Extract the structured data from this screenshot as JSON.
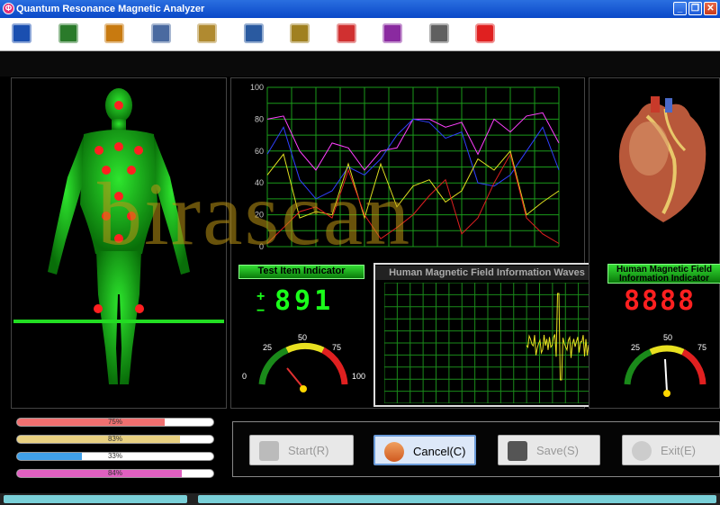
{
  "window": {
    "title": "Quantum Resonance Magnetic Analyzer",
    "min": "_",
    "restore": "❐",
    "close": "✕"
  },
  "toolbar": [
    {
      "name": "home-icon",
      "color": "#1a4fb0"
    },
    {
      "name": "users-icon",
      "color": "#2a7a2a"
    },
    {
      "name": "hand-icon",
      "color": "#c87a10"
    },
    {
      "name": "report-icon",
      "color": "#4a6aa0"
    },
    {
      "name": "edit-icon",
      "color": "#b08a30"
    },
    {
      "name": "save-disk-icon",
      "color": "#2a5aa0"
    },
    {
      "name": "export-icon",
      "color": "#a08020"
    },
    {
      "name": "settings-icon",
      "color": "#d03030"
    },
    {
      "name": "help-icon",
      "color": "#8a2aa0"
    },
    {
      "name": "user-config-icon",
      "color": "#606060"
    },
    {
      "name": "power-icon",
      "color": "#e02020"
    }
  ],
  "graph": {
    "y_ticks": [
      "100",
      "80",
      "60",
      "40",
      "20",
      "0"
    ],
    "series": [
      {
        "color": "#ff40ff",
        "values": [
          80,
          82,
          60,
          48,
          65,
          62,
          48,
          60,
          62,
          80,
          80,
          75,
          78,
          58,
          80,
          72,
          82,
          84,
          65
        ]
      },
      {
        "color": "#3040ff",
        "values": [
          58,
          75,
          42,
          30,
          35,
          50,
          45,
          55,
          70,
          80,
          78,
          68,
          72,
          40,
          38,
          45,
          60,
          75,
          48
        ]
      },
      {
        "color": "#e0e020",
        "values": [
          45,
          58,
          18,
          22,
          20,
          52,
          18,
          52,
          25,
          38,
          42,
          28,
          35,
          55,
          48,
          60,
          20,
          28,
          35
        ]
      },
      {
        "color": "#e02020",
        "values": [
          2,
          12,
          22,
          25,
          18,
          48,
          20,
          5,
          12,
          20,
          32,
          42,
          8,
          18,
          40,
          58,
          18,
          8,
          2
        ]
      }
    ]
  },
  "test_indicator": {
    "label": "Test Item Indicator",
    "plus": "+",
    "minus": "−",
    "value": "891"
  },
  "waves": {
    "title": "Human Magnetic Field Information Waves"
  },
  "field_indicator": {
    "label1": "Human Magnetic Field",
    "label2": "Information Indicator",
    "value": "8888"
  },
  "gauge_left": {
    "t0": "0",
    "t25": "25",
    "t50": "50",
    "t75": "75",
    "t100": "100"
  },
  "gauge_right": {
    "t25": "25",
    "t50": "50",
    "t75": "75"
  },
  "progress": [
    {
      "text": "75%",
      "value": 0.75,
      "color": "#f07070"
    },
    {
      "text": "83%",
      "value": 0.83,
      "color": "#e8d080"
    },
    {
      "text": "33%",
      "value": 0.33,
      "color": "#40a0e8"
    },
    {
      "text": "84%",
      "value": 0.84,
      "color": "#e060c0"
    }
  ],
  "buttons": {
    "start": "Start(R)",
    "cancel": "Cancel(C)",
    "save": "Save(S)",
    "exit": "Exit(E)"
  },
  "watermark": "birascan"
}
